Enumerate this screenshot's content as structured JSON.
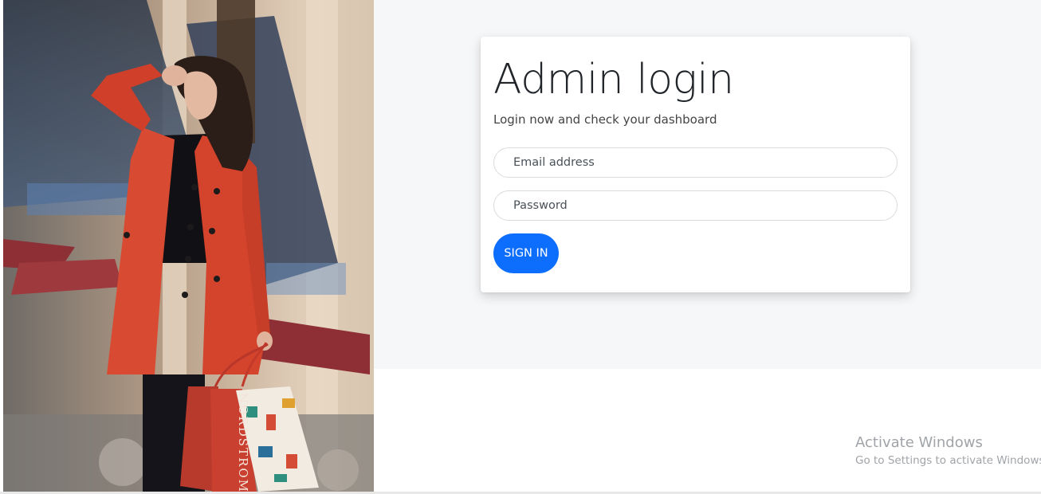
{
  "hero": {
    "image_label": "photo",
    "bag_text": "NORDSTROM"
  },
  "login": {
    "title": "Admin login",
    "subtitle": "Login now and check your dashboard",
    "email_placeholder": "Email address",
    "password_placeholder": "Password",
    "sign_in_label": "SIGN IN"
  },
  "watermark": {
    "title": "Activate Windows",
    "subtitle": "Go to Settings to activate Windows"
  },
  "colors": {
    "primary": "#0d6efd",
    "panel_bg": "#f6f7f9",
    "coat": "#d94a32"
  }
}
